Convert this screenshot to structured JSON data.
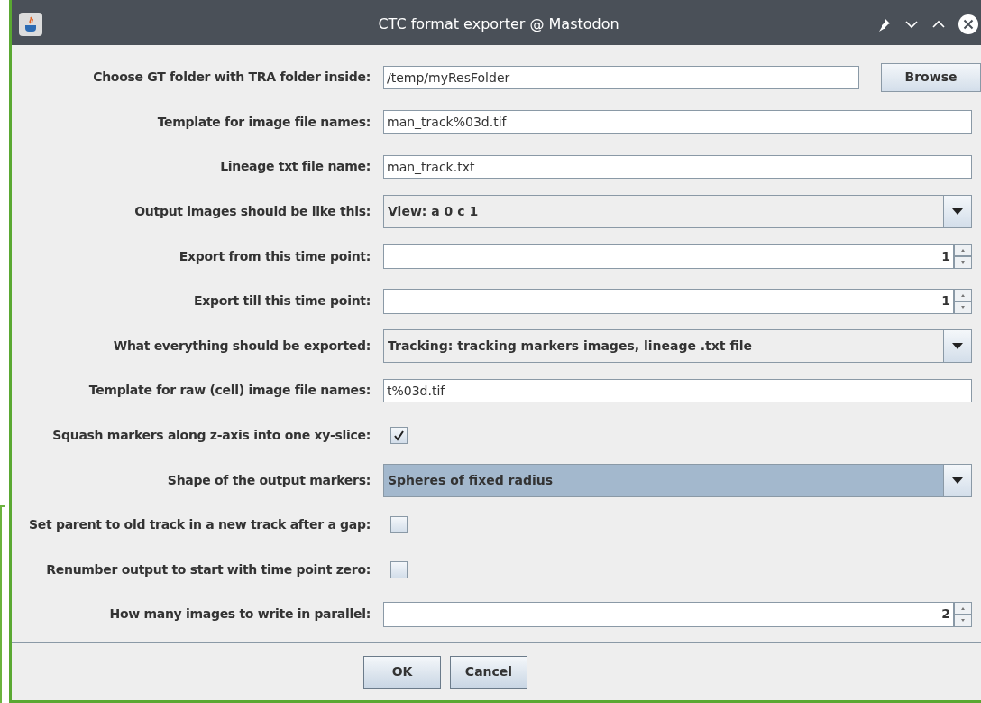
{
  "window": {
    "title": "CTC format exporter @ Mastodon"
  },
  "rows": [
    {
      "kind": "text",
      "label": "Choose GT folder with TRA folder inside:",
      "value": "/temp/myResFolder",
      "button": "Browse"
    },
    {
      "kind": "text",
      "label": "Template for image file names:",
      "value": "man_track%03d.tif"
    },
    {
      "kind": "text",
      "label": "Lineage txt file name:",
      "value": "man_track.txt"
    },
    {
      "kind": "combo",
      "label": "Output images should be like this:",
      "value": "View: a 0 c 1",
      "focused": false
    },
    {
      "kind": "spinner",
      "label": "Export from this time point:",
      "value": "1"
    },
    {
      "kind": "spinner",
      "label": "Export till this time point:",
      "value": "1"
    },
    {
      "kind": "combo",
      "label": "What everything should be exported:",
      "value": "Tracking: tracking markers images, lineage .txt file",
      "focused": false
    },
    {
      "kind": "text",
      "label": "Template for raw (cell) image file names:",
      "value": "t%03d.tif"
    },
    {
      "kind": "checkbox",
      "label": "Squash markers along z-axis into one xy-slice:",
      "checked": true
    },
    {
      "kind": "combo",
      "label": "Shape of the output markers:",
      "value": "Spheres of fixed radius",
      "focused": true
    },
    {
      "kind": "checkbox",
      "label": "Set parent to old track in a new track after a gap:",
      "checked": false
    },
    {
      "kind": "checkbox",
      "label": "Renumber output to start with time point zero:",
      "checked": false
    },
    {
      "kind": "spinner",
      "label": "How many images to write in parallel:",
      "value": "2"
    }
  ],
  "buttons": [
    "OK",
    "Cancel"
  ]
}
